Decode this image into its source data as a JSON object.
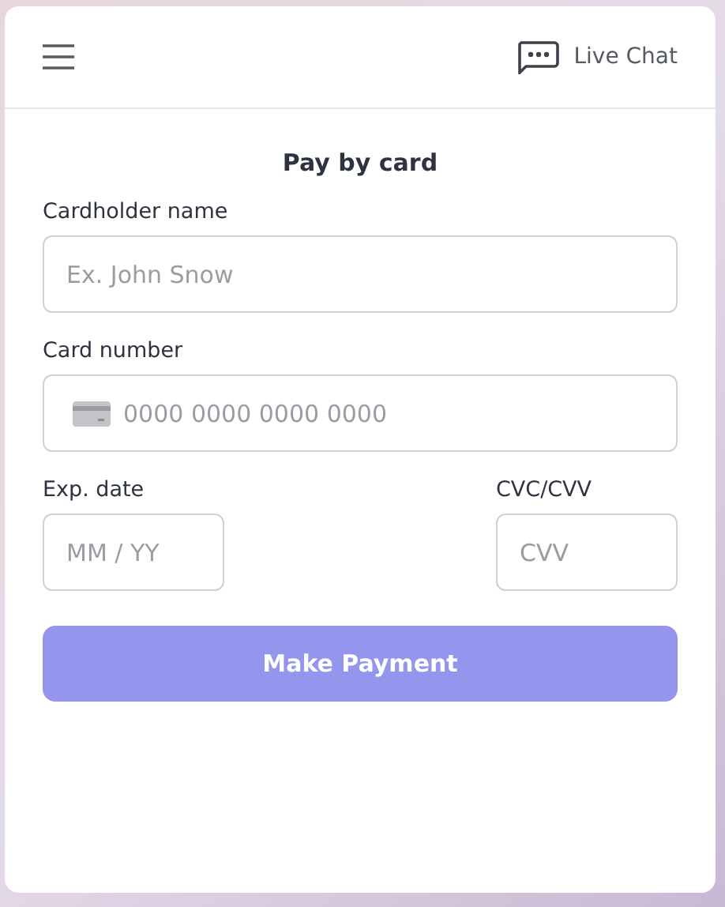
{
  "header": {
    "live_chat": "Live Chat"
  },
  "title": "Pay by card",
  "fields": [
    {
      "label": "Cardholder name",
      "placeholder": "Ex. John Snow",
      "kind": "text"
    },
    {
      "label": "Card number",
      "placeholder": "0000 0000 0000 0000",
      "kind": "card"
    }
  ],
  "expiry": {
    "label": "Exp. date",
    "placeholder": "MM / YY"
  },
  "cvc": {
    "label": "CVC/CVV",
    "placeholder": "CVV"
  },
  "submit": {
    "label": "Make Payment",
    "disabled": true
  }
}
